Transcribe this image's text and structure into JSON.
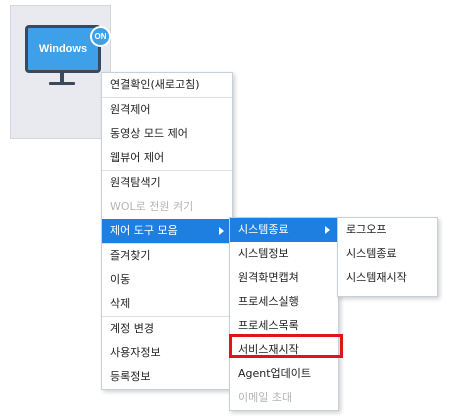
{
  "device": {
    "os_label": "Windows",
    "status_badge": "ON",
    "icon": "monitor-icon"
  },
  "context_menu": {
    "groups": [
      [
        "연결확인(새로고침)"
      ],
      [
        "원격제어",
        "동영상 모드 제어",
        "웹뷰어 제어"
      ],
      [
        "원격탐색기",
        "WOL로 전원 켜기",
        "제어 도구 모음"
      ],
      [
        "즐겨찾기",
        "이동",
        "삭제"
      ],
      [
        "계정 변경",
        "사용자정보",
        "등록정보"
      ]
    ],
    "disabled_item": "WOL로 전원 켜기",
    "active_item": "제어 도구 모음"
  },
  "tools_submenu": {
    "items": [
      "시스템종료",
      "시스템정보",
      "원격화면캡쳐",
      "프로세스실행",
      "프로세스목록",
      "서비스재시작",
      "Agent업데이트",
      "이메일 초대"
    ],
    "active_item": "시스템종료",
    "disabled_item": "이메일 초대",
    "highlighted_item": "서비스재시작"
  },
  "shutdown_submenu": {
    "items": [
      "로그오프",
      "시스템종료",
      "시스템재시작"
    ]
  },
  "colors": {
    "accent": "#1f7fe0",
    "monitor": "#3da0e8",
    "highlight_border": "#e3131b"
  }
}
